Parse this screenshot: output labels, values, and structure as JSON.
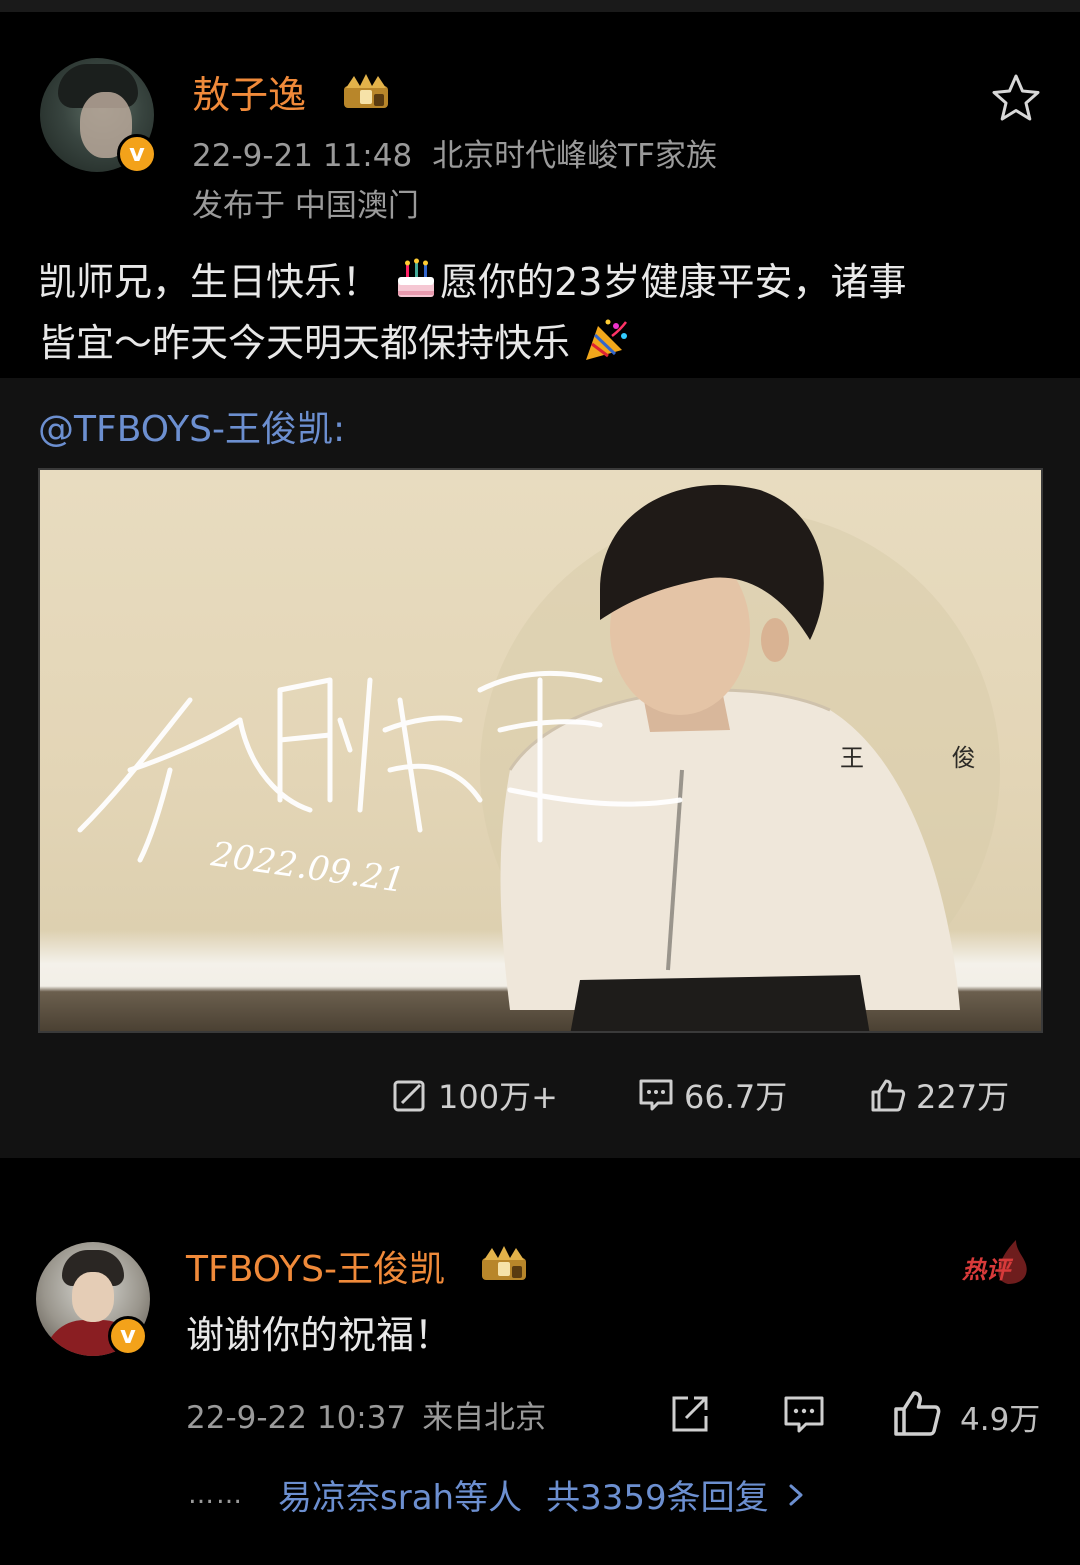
{
  "post": {
    "username": "敖子逸",
    "timestamp": "22-9-21 11:48",
    "source": "北京时代峰峻TF家族",
    "location": "发布于 中国澳门",
    "text_line1": "凯师兄，生日快乐！",
    "text_line1b": "愿你的23岁健康平安，诸事",
    "text_line2": "皆宜～昨天今天明天都保持快乐",
    "icons": {
      "favorite": "star-icon",
      "verified": "v-badge-icon",
      "member": "crown-icon",
      "cake": "birthday-cake-emoji",
      "party": "party-popper-emoji"
    }
  },
  "repost": {
    "mention": "@TFBOYS-王俊凯:",
    "image": {
      "handwriting": "生日快乐",
      "date": "2022.09.21",
      "signature": "王 俊"
    }
  },
  "actions": {
    "repost_count": "100万+",
    "comment_count": "66.7万",
    "like_count": "227万"
  },
  "comment": {
    "username": "TFBOYS-王俊凯",
    "hot_label": "热评",
    "text": "谢谢你的祝福！",
    "timestamp": "22-9-22 10:37",
    "location": "来自北京",
    "likes": "4.9万",
    "replies_ellipsis": "……",
    "replies_users": "易凉奈srah等人",
    "replies_count": "共3359条回复"
  },
  "colors": {
    "background": "#000000",
    "repost_background": "#121212",
    "username": "#f08a3a",
    "link": "#6c8fd0",
    "meta": "#9a9a9a",
    "verified": "#f3a21a",
    "hot": "#d83a3a"
  }
}
